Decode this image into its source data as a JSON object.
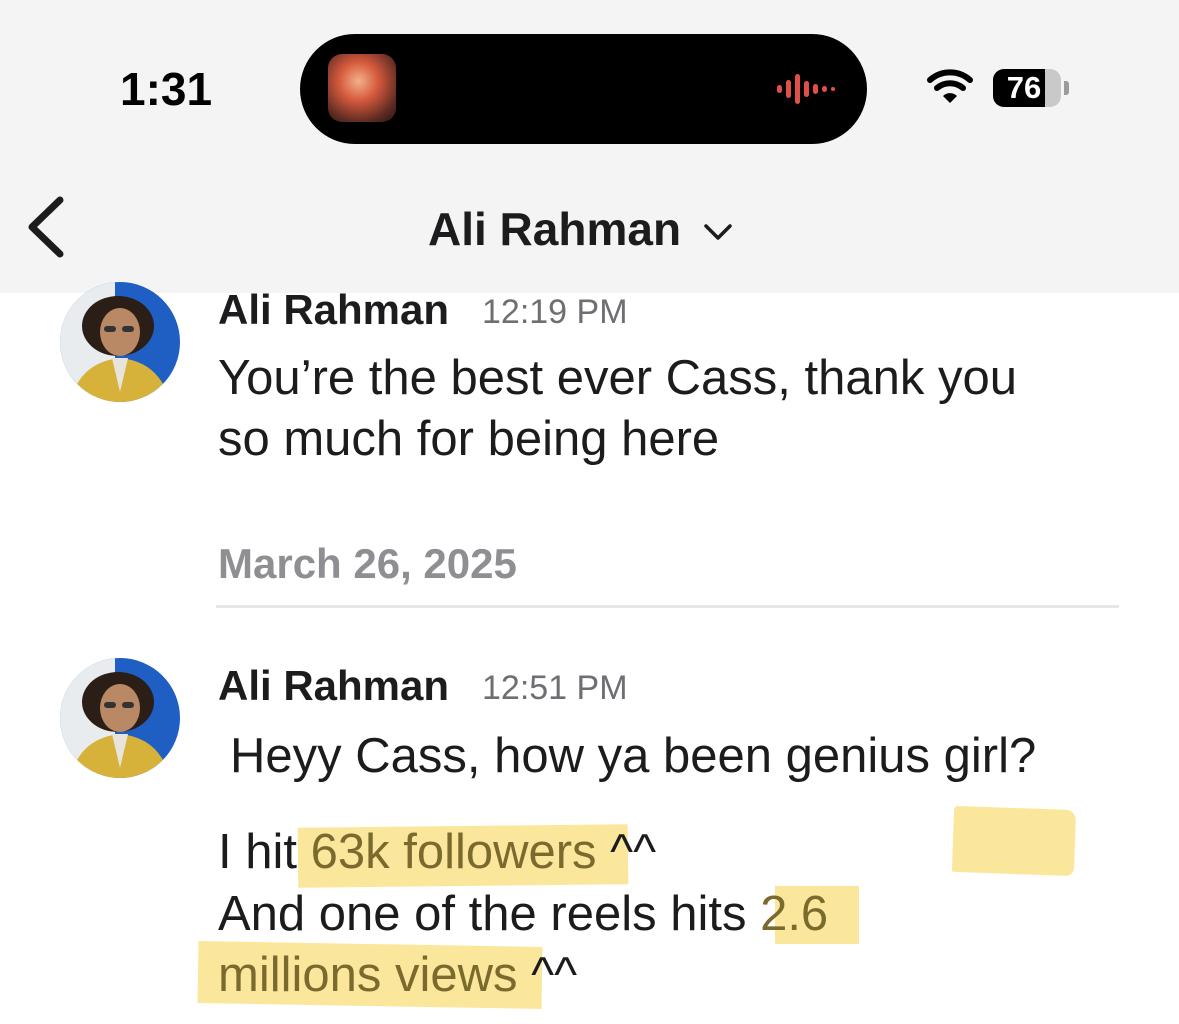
{
  "status_bar": {
    "time": "1:31",
    "battery_level": "76",
    "battery_fraction": 0.76,
    "icons": [
      "now-playing-thumbnail",
      "audio-waveform-icon",
      "wifi-icon",
      "battery-icon"
    ]
  },
  "header": {
    "title": "Ali Rahman",
    "back_icon": "chevron-left-icon",
    "dropdown_icon": "chevron-down-icon"
  },
  "messages": [
    {
      "sender": "Ali Rahman",
      "time": "12:19 PM",
      "lines": [
        "You’re the best ever Cass, thank you",
        "so much for being here"
      ]
    },
    {
      "sender": "Ali Rahman",
      "time": "12:51 PM",
      "line1": "Heyy Cass, how ya been genius girl?",
      "line2_prefix": "I hit ",
      "line2_highlight": "63k followers",
      "line2_suffix": " ^^",
      "line3_prefix": "And one of the reels hits ",
      "line3_highlight": "2.6",
      "line4_highlight": "millions views",
      "line4_suffix": " ^^"
    }
  ],
  "date_separator": "March 26, 2025",
  "colors": {
    "highlight": "#fbe593",
    "highlight_text": "#7a6a2e",
    "waveform": "#e0504a",
    "topbar_bg": "#f4f4f4"
  }
}
